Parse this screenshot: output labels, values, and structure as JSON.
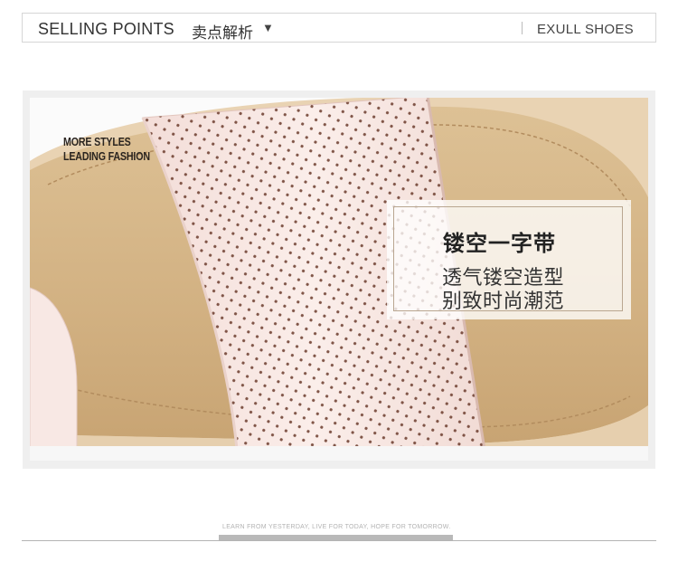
{
  "header": {
    "title_en": "SELLING POINTS",
    "title_cn": "卖点解析",
    "caret": "▼",
    "brand": "EXULL SHOES"
  },
  "banner": {
    "tagline_line1": "MORE STYLES",
    "tagline_line2": "LEADING FASHION",
    "feature_title": "镂空一字带",
    "feature_line1": "透气镂空造型",
    "feature_line2": "别致时尚潮范"
  },
  "footer": {
    "slogan": "LEARN FROM YESTERDAY, LIVE FOR TODAY, HOPE FOR TOMORROW."
  },
  "colors": {
    "insole": "#d6b889",
    "strap": "#f7e6e2",
    "caption_border": "#b9a690"
  }
}
